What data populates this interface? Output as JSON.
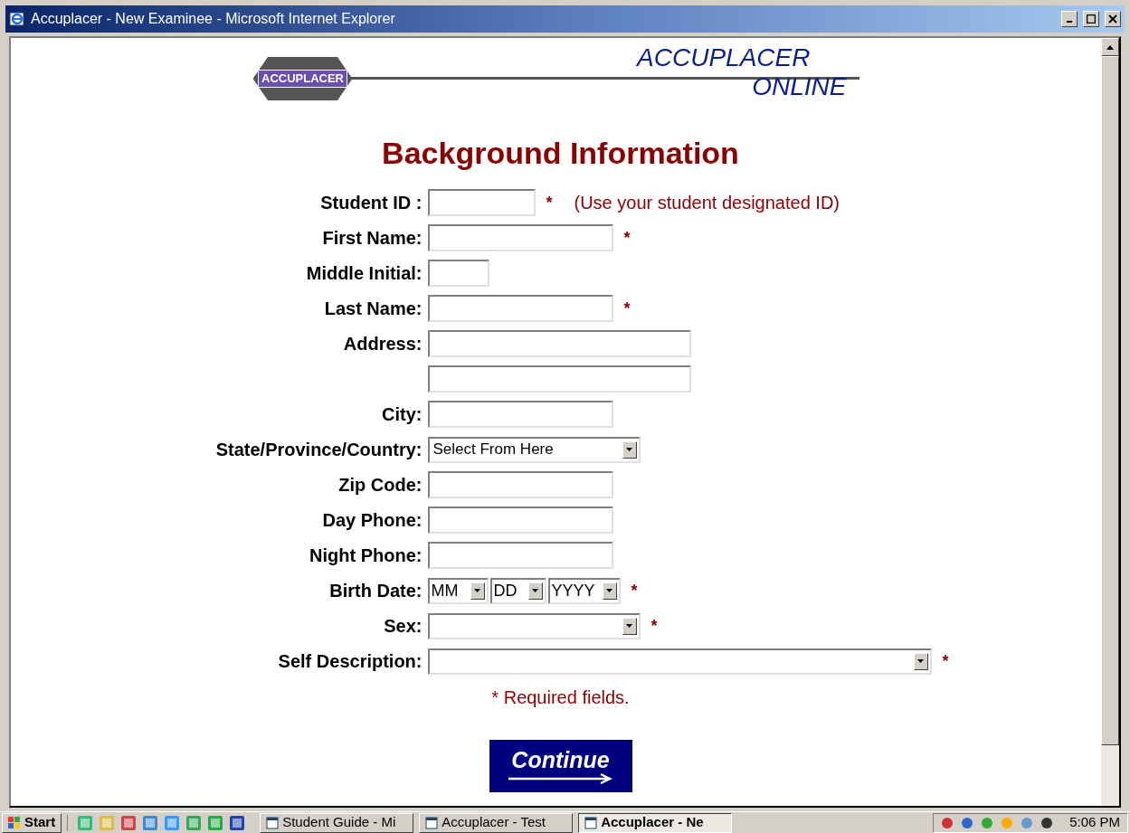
{
  "window": {
    "title": "Accuplacer - New Examinee - Microsoft Internet Explorer"
  },
  "header": {
    "logo_text": "ACCUPLACER",
    "brand_line1": "ACCUPLACER",
    "brand_line2": "ONLINE"
  },
  "heading": "Background Information",
  "fields": [
    {
      "label": "Student ID :",
      "kind": "shortbox",
      "required": "*",
      "note": "(Use your student designated ID)"
    },
    {
      "label": "First Name:",
      "kind": "box",
      "required": "*"
    },
    {
      "label": "Middle Initial:",
      "kind": "tinybox"
    },
    {
      "label": "Last Name:",
      "kind": "box",
      "required": "*"
    },
    {
      "label": "Address:",
      "kind": "longbox"
    },
    {
      "kind": "longbox"
    },
    {
      "label": "City:",
      "kind": "box"
    },
    {
      "label": "State/Province/Country:",
      "kind": "select",
      "value": "Select From Here"
    },
    {
      "label": "Zip Code:",
      "kind": "box"
    },
    {
      "label": "Day Phone:",
      "kind": "box"
    },
    {
      "label": "Night Phone:",
      "kind": "box"
    },
    {
      "label": "Birth Date:",
      "kind": "date",
      "parts": [
        "MM",
        "DD",
        "YYYY"
      ],
      "required": "*"
    },
    {
      "label": "Sex:",
      "kind": "select",
      "required": "*"
    },
    {
      "label": "Self Description:",
      "kind": "wideselect",
      "required": "*"
    }
  ],
  "required_note": "* Required fields.",
  "continue_button": "Continue",
  "taskbar": {
    "start": "Start",
    "tasks": [
      {
        "label": "Student Guide - Mi",
        "selected": false
      },
      {
        "label": "Accuplacer - Test",
        "selected": false
      },
      {
        "label": "Accuplacer - Ne",
        "selected": true
      }
    ],
    "clock": "5:06 PM"
  }
}
